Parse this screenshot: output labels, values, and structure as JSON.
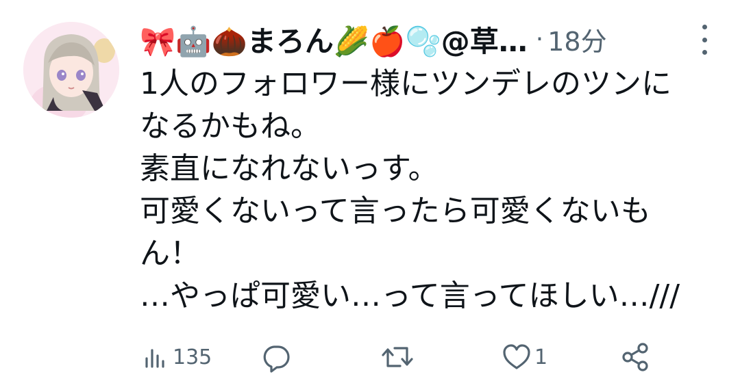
{
  "tweet": {
    "display_name": "🎀🤖🌰まろん🌽🍎🫧@草…",
    "separator": "·",
    "timestamp": "18分",
    "lines": [
      "1人のフォロワー様にツンデレのツンに",
      "なるかもね。",
      "素直になれないっす。",
      "可愛くないって言ったら可愛くないも",
      "ん！",
      "…やっぱ可愛い…って言ってほしい…///"
    ]
  },
  "actions": {
    "views": {
      "icon": "views-icon",
      "count": "135"
    },
    "reply": {
      "icon": "reply-icon",
      "count": ""
    },
    "retweet": {
      "icon": "retweet-icon",
      "count": ""
    },
    "like": {
      "icon": "heart-icon",
      "count": "1"
    },
    "share": {
      "icon": "share-icon",
      "count": ""
    }
  },
  "colors": {
    "text": "#0f1419",
    "secondary": "#536471",
    "avatar_bg": "#fbe9f1"
  }
}
